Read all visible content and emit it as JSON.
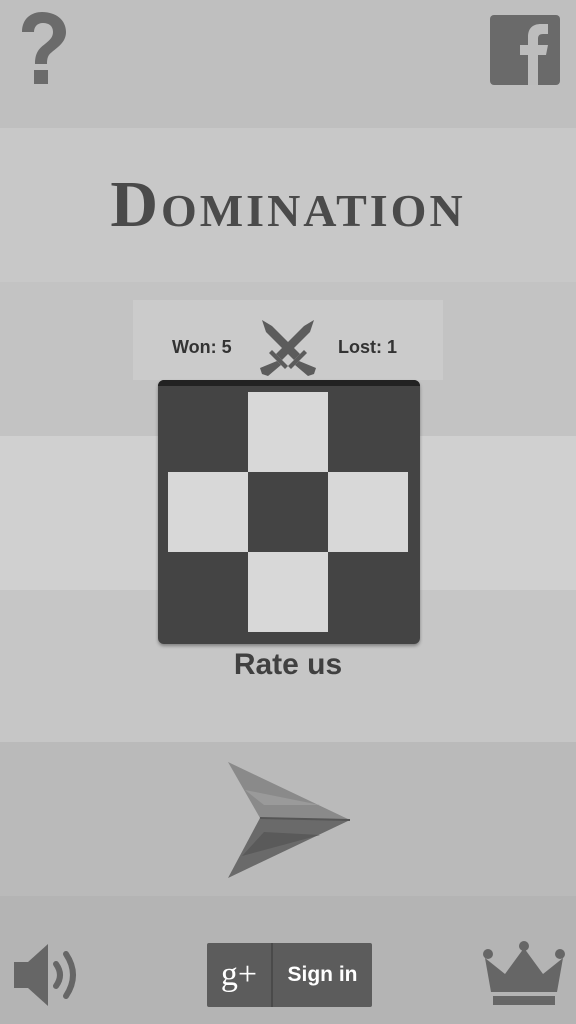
{
  "app": {
    "title": "Domination"
  },
  "stats": {
    "won": "Won: 5",
    "lost": "Lost: 1"
  },
  "board": {
    "cells": [
      [
        "dark",
        "light",
        "dark"
      ],
      [
        "light",
        "dark",
        "light"
      ],
      [
        "dark",
        "light",
        "dark"
      ]
    ]
  },
  "rate_label": "Rate us",
  "signin": {
    "logo": "g+",
    "label": "Sign in"
  },
  "icons": {
    "help": "question-mark-icon",
    "facebook": "facebook-icon",
    "versus": "crossed-swords-icon",
    "play": "play-arrow-icon",
    "sound": "speaker-icon",
    "leaderboard": "crown-icon"
  },
  "colors": {
    "icon_gray": "#6b6b6b",
    "board_dark": "#444444",
    "board_light": "#d8d8d8"
  }
}
